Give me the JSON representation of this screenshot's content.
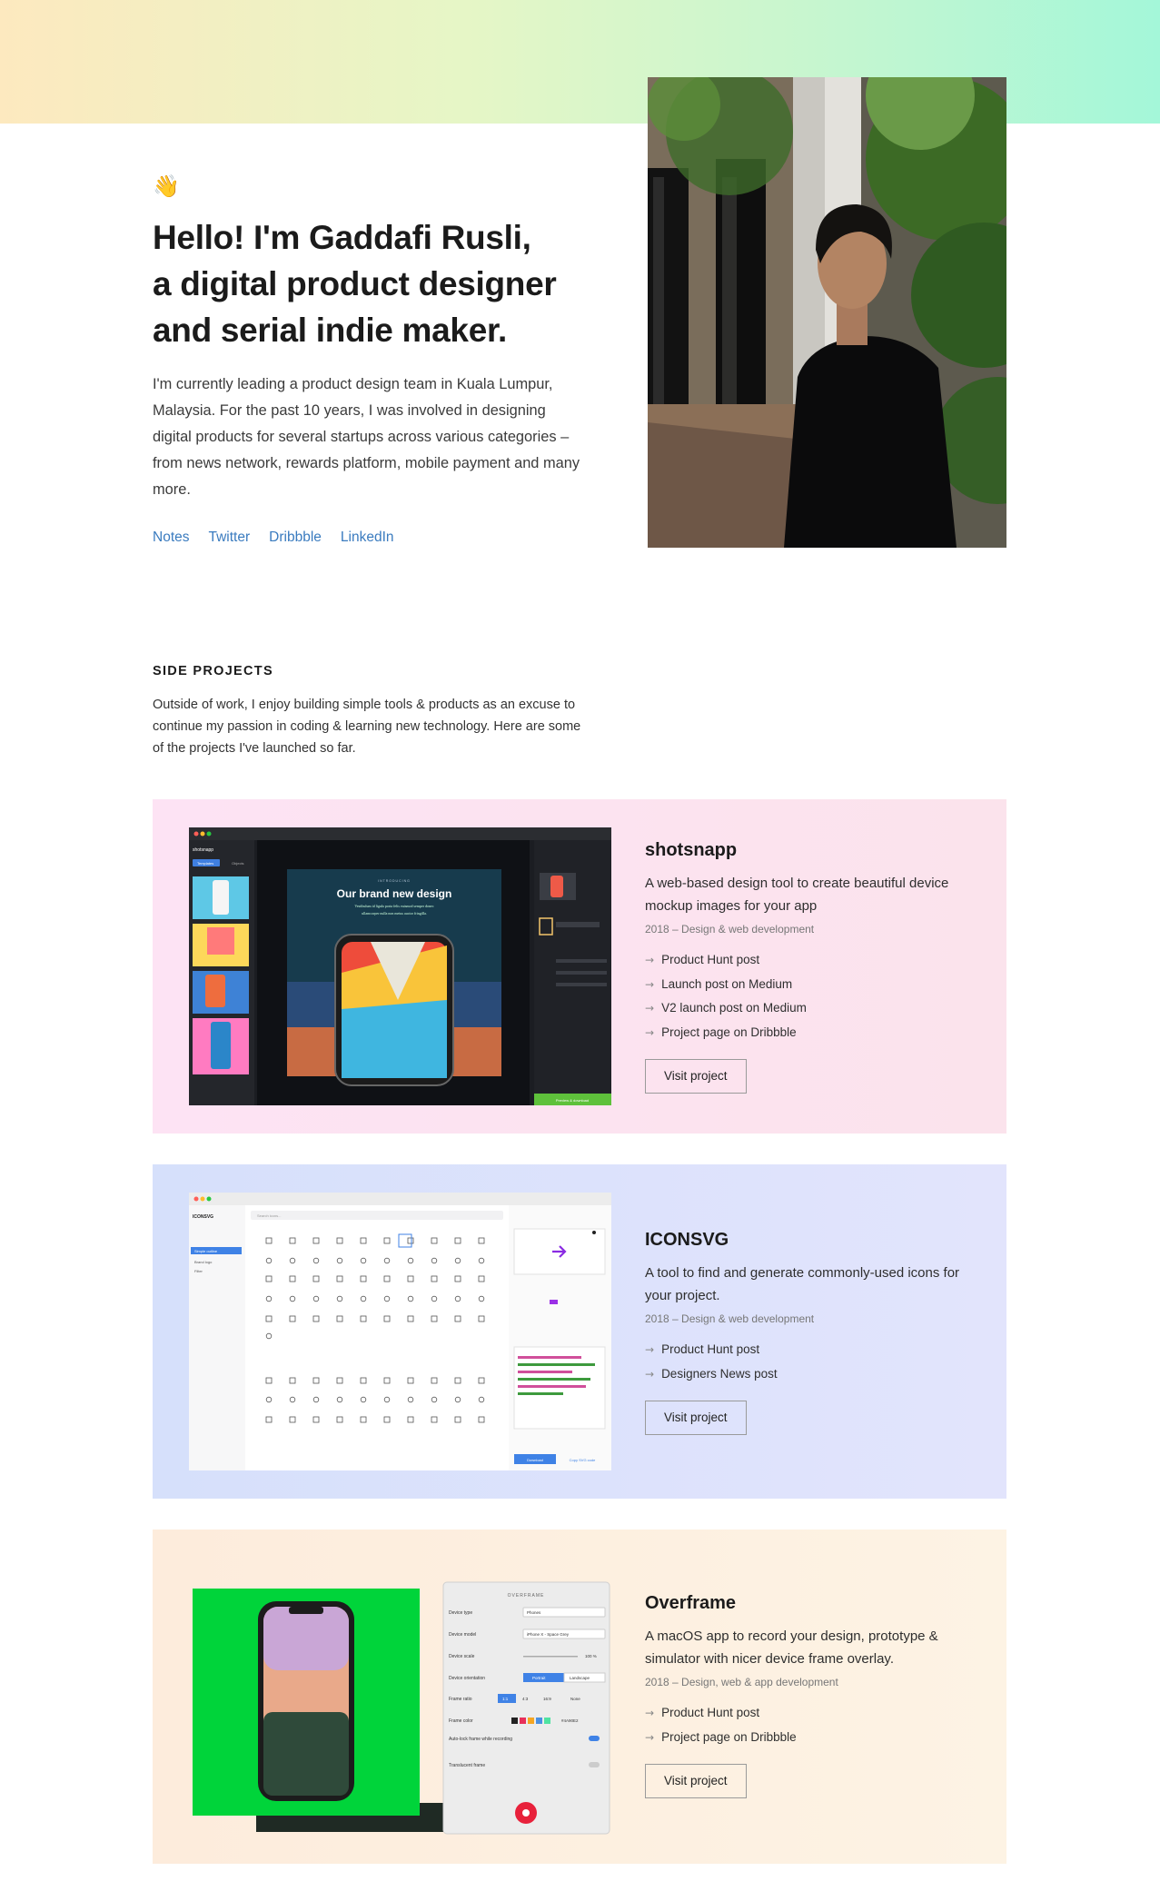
{
  "hero": {
    "wave_icon": "👋",
    "title_line1": "Hello! I'm Gaddafi Rusli,",
    "title_line2": "a digital product designer",
    "title_line3": "and serial indie maker.",
    "bio": "I'm currently leading a product design team in Kuala Lumpur, Malaysia. For the past 10 years, I was involved in designing digital products for several startups across various categories – from news network, rewards platform, mobile payment and many more.",
    "links": [
      "Notes",
      "Twitter",
      "Dribbble",
      "LinkedIn"
    ],
    "link_color": "#3a7bbf"
  },
  "side_projects": {
    "heading": "SIDE PROJECTS",
    "intro": "Outside of work, I enjoy building simple tools & products as an excuse to continue my passion in coding & learning new technology. Here are some of the projects I've launched so far.",
    "projects": [
      {
        "title": "shotsnapp",
        "description": "A web-based design tool to create beautiful device mockup images for your app",
        "meta": "2018 – Design & web development",
        "links": [
          "Product Hunt post",
          "Launch post on Medium",
          "V2 launch post on Medium",
          "Project page on Dribbble"
        ],
        "button": "Visit project",
        "screenshot": {
          "app_name": "shotsnapp",
          "tab1": "Templates",
          "tab2": "Objects",
          "headline_small": "INTRODUCING",
          "headline": "Our brand new design",
          "subline1": "Vestibulum id ligula porta felis euismod semper donec",
          "subline2": "ullamcorper nulla non metus auctor fringilla.",
          "cta": "Preview & download"
        }
      },
      {
        "title": "ICONSVG",
        "description": "A tool to find and generate commonly-used icons for your project.",
        "meta": "2018 – Design & web development",
        "links": [
          "Product Hunt post",
          "Designers News post"
        ],
        "button": "Visit project",
        "screenshot": {
          "app_name": "ICONSVG",
          "search": "Search icons...",
          "nav": [
            "Simple outline",
            "Brand logo",
            "Filter"
          ],
          "download": "Download",
          "copy": "Copy SVG code"
        }
      },
      {
        "title": "Overframe",
        "description": "A macOS app to record your design, prototype & simulator with nicer device frame overlay.",
        "meta": "2018 – Design, web & app development",
        "links": [
          "Product Hunt post",
          "Project page on Dribbble"
        ],
        "button": "Visit project",
        "screenshot": {
          "panel_title": "OVERFRAME",
          "rows": [
            {
              "label": "Device type",
              "value": "Phones"
            },
            {
              "label": "Device model",
              "value": "iPhone X - Space Grey"
            },
            {
              "label": "Device scale",
              "value": "100 %"
            },
            {
              "label": "Device orientation",
              "value": "Portrait"
            },
            {
              "label": "Frame ratio",
              "value": "1:1"
            },
            {
              "label": "Frame color",
              "value": "#4A90E2"
            }
          ],
          "toggle1": "Auto-lock frame while recording",
          "toggle2": "Translucent frame",
          "landscape": "Landscape",
          "ratios": [
            "4:3",
            "16:9",
            "None"
          ]
        }
      }
    ]
  },
  "colors": {
    "card1": "#fde3f4",
    "card2": "#d6e0fb",
    "card3": "#fdecdc",
    "overframe_green": "#00d43a"
  }
}
